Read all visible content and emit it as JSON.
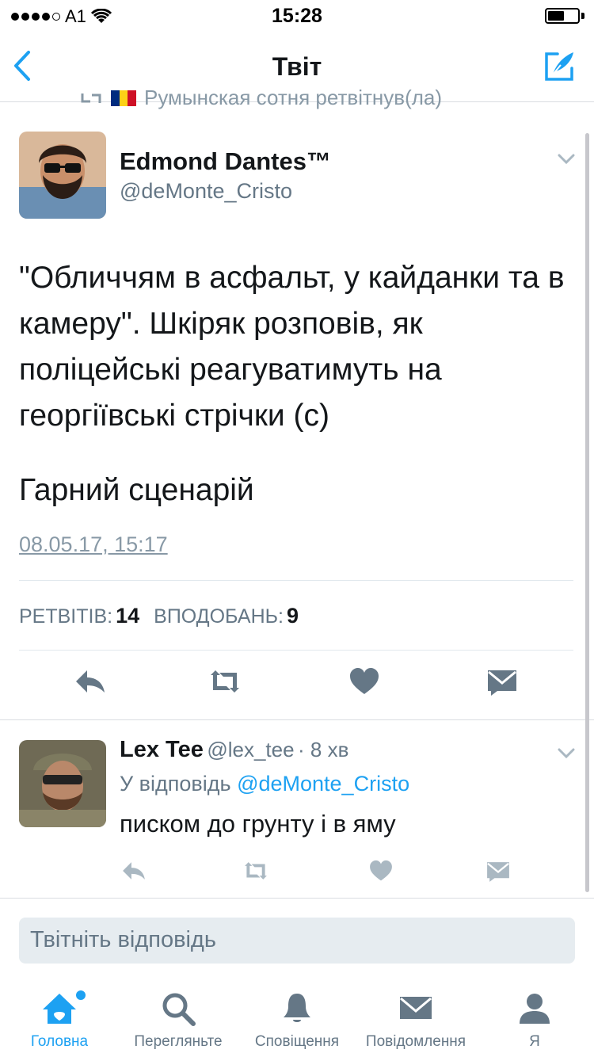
{
  "status_bar": {
    "carrier": "A1",
    "time": "15:28",
    "battery_level": 0.55
  },
  "nav": {
    "title": "Твіт"
  },
  "retweet_context": {
    "text": "Румынская сотня ретвітнув(ла)"
  },
  "tweet": {
    "author_name": "Edmond Dantes™",
    "author_handle": "@deMonte_Cristo",
    "text": "\"Обличчям в асфальт, у кайданки та в камеру\". Шкіряк розповів, як поліцейські реагуватимуть на георгіївські стрічки (с)",
    "text_second": "Гарний сценарій",
    "date": "08.05.17, 15:17",
    "retweets_label": "РЕТВІТІВ:",
    "retweets_count": "14",
    "likes_label": "ВПОДОБАНЬ:",
    "likes_count": "9"
  },
  "reply": {
    "author_name": "Lex Tee",
    "author_handle": "@lex_tee",
    "time": "· 8 хв",
    "reply_to_prefix": "У відповідь",
    "reply_to_handle": "@deMonte_Cristo",
    "text": "писком до грунту і в яму"
  },
  "reply_box": {
    "placeholder": "Твітніть відповідь"
  },
  "tabs": [
    {
      "label": "Головна",
      "icon": "home-icon",
      "active": true
    },
    {
      "label": "Перегляньте",
      "icon": "search-icon",
      "active": false
    },
    {
      "label": "Сповіщення",
      "icon": "bell-icon",
      "active": false
    },
    {
      "label": "Повідомлення",
      "icon": "envelope-icon",
      "active": false
    },
    {
      "label": "Я",
      "icon": "person-icon",
      "active": false
    }
  ],
  "colors": {
    "accent": "#1da1f2",
    "text": "#14171a",
    "secondary": "#657786",
    "action_gray": "#657786",
    "light_action_gray": "#aab8c2"
  }
}
